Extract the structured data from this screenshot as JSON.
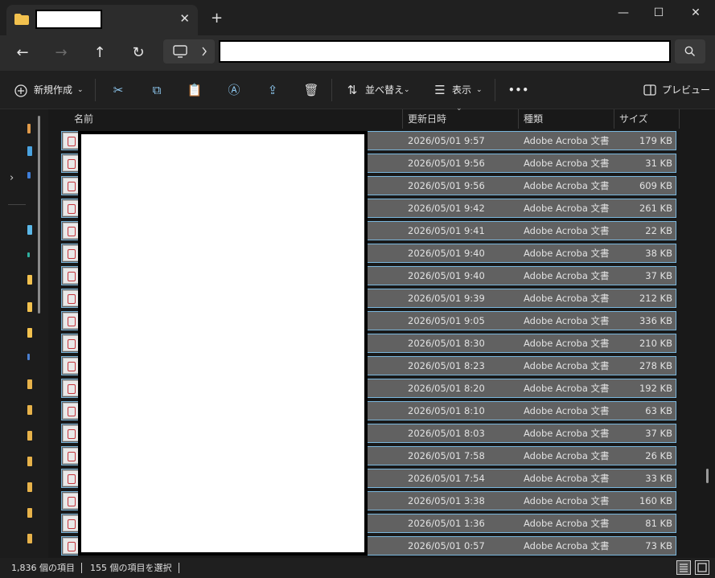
{
  "window": {
    "tab_title": "",
    "tab_close": "✕",
    "new_tab": "+",
    "minimize": "—",
    "maximize": "☐",
    "close": "✕"
  },
  "nav": {
    "back": "←",
    "forward": "→",
    "up": "↑",
    "refresh": "↻",
    "address": "",
    "search_icon": "search-icon"
  },
  "toolbar": {
    "new_label": "新規作成",
    "sort_label": "並べ替え",
    "view_label": "表示",
    "more_label": "•••",
    "preview_label": "プレビュー"
  },
  "columns": {
    "name": "名前",
    "date": "更新日時",
    "type": "種類",
    "size": "サイズ"
  },
  "files": [
    {
      "date": "2026/05/01 9:57",
      "type": "Adobe Acroba 文書",
      "size": "179 KB"
    },
    {
      "date": "2026/05/01 9:56",
      "type": "Adobe Acroba 文書",
      "size": "31 KB"
    },
    {
      "date": "2026/05/01 9:56",
      "type": "Adobe Acroba 文書",
      "size": "609 KB"
    },
    {
      "date": "2026/05/01 9:42",
      "type": "Adobe Acroba 文書",
      "size": "261 KB"
    },
    {
      "date": "2026/05/01 9:41",
      "type": "Adobe Acroba 文書",
      "size": "22 KB"
    },
    {
      "date": "2026/05/01 9:40",
      "type": "Adobe Acroba 文書",
      "size": "38 KB"
    },
    {
      "date": "2026/05/01 9:40",
      "type": "Adobe Acroba 文書",
      "size": "37 KB"
    },
    {
      "date": "2026/05/01 9:39",
      "type": "Adobe Acroba 文書",
      "size": "212 KB"
    },
    {
      "date": "2026/05/01 9:05",
      "type": "Adobe Acroba 文書",
      "size": "336 KB"
    },
    {
      "date": "2026/05/01 8:30",
      "type": "Adobe Acroba 文書",
      "size": "210 KB"
    },
    {
      "date": "2026/05/01 8:23",
      "type": "Adobe Acroba 文書",
      "size": "278 KB"
    },
    {
      "date": "2026/05/01 8:20",
      "type": "Adobe Acroba 文書",
      "size": "192 KB"
    },
    {
      "date": "2026/05/01 8:10",
      "type": "Adobe Acroba 文書",
      "size": "63 KB"
    },
    {
      "date": "2026/05/01 8:03",
      "type": "Adobe Acroba 文書",
      "size": "37 KB"
    },
    {
      "date": "2026/05/01 7:58",
      "type": "Adobe Acroba 文書",
      "size": "26 KB"
    },
    {
      "date": "2026/05/01 7:54",
      "type": "Adobe Acroba 文書",
      "size": "33 KB"
    },
    {
      "date": "2026/05/01 3:38",
      "type": "Adobe Acroba 文書",
      "size": "160 KB"
    },
    {
      "date": "2026/05/01 1:36",
      "type": "Adobe Acroba 文書",
      "size": "81 KB"
    },
    {
      "date": "2026/05/01 0:57",
      "type": "Adobe Acroba 文書",
      "size": "73 KB"
    }
  ],
  "status": {
    "item_count": "1,836 個の項目",
    "selected_count": "155 個の項目を選択"
  },
  "colors": {
    "accent": "#8ec8f0",
    "selection_fill": "#616161",
    "selection_border": "#7ab7dd",
    "pdf_red": "#c4343b"
  }
}
